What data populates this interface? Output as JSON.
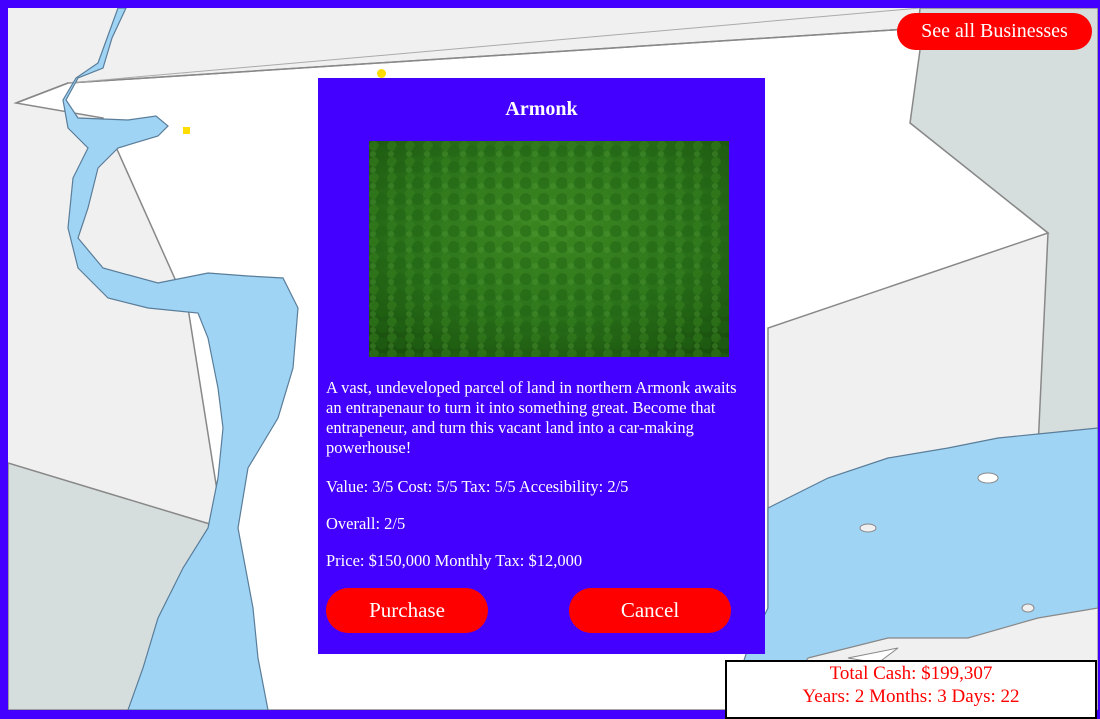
{
  "header": {
    "see_all_label": "See all Businesses"
  },
  "modal": {
    "title": "Armonk",
    "image": "forest-aerial-photo",
    "description": "A vast, undeveloped parcel of land in northern Armonk awaits an entrapenaur to turn it into something great. Become that entrapeneur, and turn this vacant land into a car-making powerhouse!",
    "ratings": "Value: 3/5 Cost: 5/5 Tax: 5/5 Accesibility: 2/5",
    "overall": "Overall: 2/5",
    "price": "Price: $150,000 Monthly Tax: $12,000",
    "purchase_label": "Purchase",
    "cancel_label": "Cancel"
  },
  "status": {
    "cash": "Total Cash: $199,307",
    "date": "Years: 2 Months: 3 Days: 22"
  },
  "colors": {
    "accent": "#4400ff",
    "button": "#ff0000",
    "water": "#9fd4f5",
    "land": "#f0f0f0",
    "region": "#ffffff",
    "marker": "#ffdd00"
  }
}
